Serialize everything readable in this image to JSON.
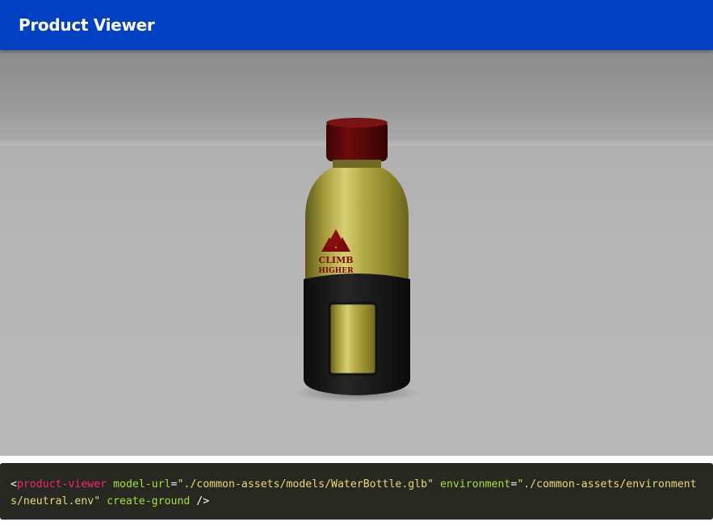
{
  "header": {
    "title": "Product Viewer"
  },
  "viewer": {
    "model_description_icon": "water-bottle-model",
    "bottle_label_line1": "CLIMB",
    "bottle_label_line2": "HIGHER"
  },
  "code": {
    "open": "<",
    "tag": "product-viewer",
    "attr1_name": "model-url",
    "eq": "=",
    "attr1_value": "\"./common-assets/models/WaterBottle.glb\"",
    "attr2_name": "environment",
    "attr2_value": "\"./common-assets/environments/neutral.env\"",
    "attr3_name": "create-ground",
    "close": "/>"
  },
  "colors": {
    "app_bar": "#0040c1",
    "code_bg": "#272822",
    "tag": "#f92672",
    "attr": "#a6e22e",
    "string": "#e6db74"
  }
}
